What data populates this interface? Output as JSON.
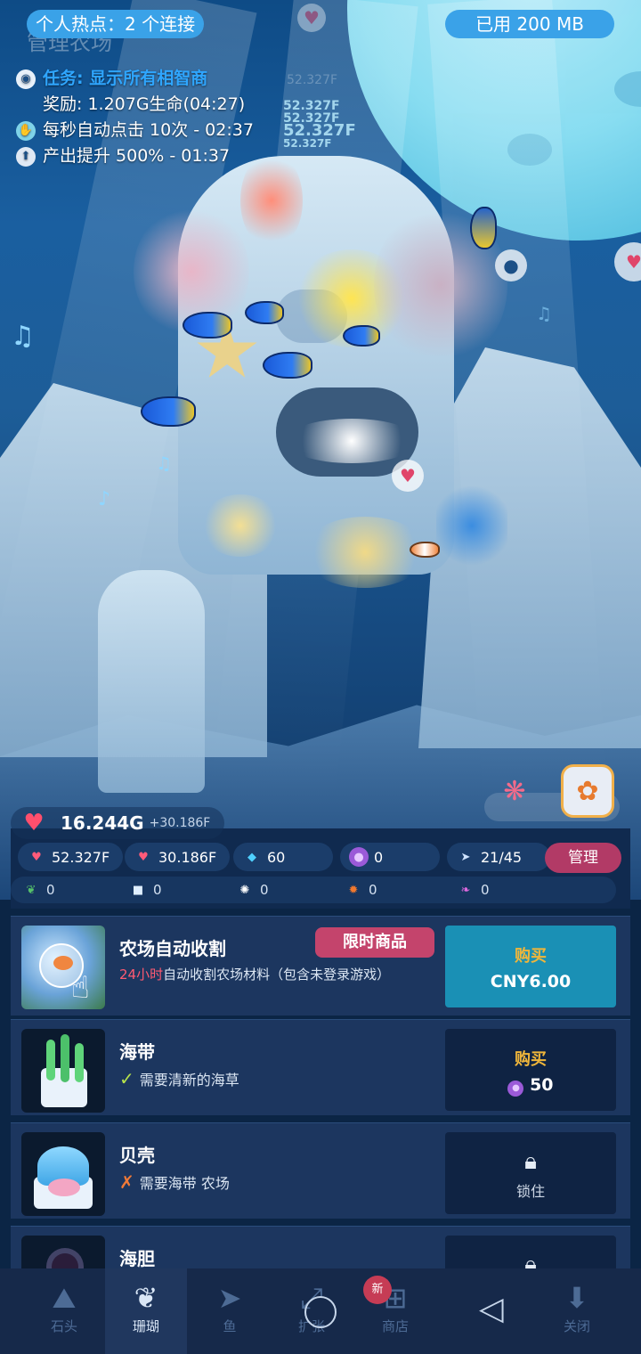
{
  "status_bar": {
    "hotspot": "个人热点：2 个连接",
    "data_used": "已用 200 MB"
  },
  "farm_title": "管理农场",
  "info": {
    "task_label": "任务",
    "task_text": ": 显示所有相智商",
    "reward": "奖励: 1.207G生命(04:27)",
    "auto_click": "每秒自动点击 10次 - 02:37",
    "production_boost": "产出提升 500% - 01:37"
  },
  "floating_numbers": [
    "52.327F",
    "52.327F",
    "52.327F",
    "52.327F",
    "52.327F"
  ],
  "life": {
    "value": "16.244G",
    "rate": "+30.186F"
  },
  "stats": {
    "tap_life": "52.327F",
    "auto_life": "30.186F",
    "gems": "60",
    "pearls": "0",
    "fish": "21/45",
    "manage_label": "管理"
  },
  "materials": [
    "0",
    "0",
    "0",
    "0",
    "0"
  ],
  "shop": {
    "items": [
      {
        "name": "农场自动收割",
        "tag": "限时商品",
        "desc_highlight": "24小时",
        "desc": "自动收割农场材料（包含未登录游戏）",
        "buy_label": "购买",
        "price": "CNY6.00"
      },
      {
        "name": "海带",
        "desc": "需要清新的海草",
        "buy_label": "购买",
        "price": "50"
      },
      {
        "name": "贝壳",
        "desc": "需要海带 农场",
        "lock_label": "锁住"
      },
      {
        "name": "海胆"
      }
    ]
  },
  "nav": {
    "items": [
      "石头",
      "珊瑚",
      "鱼",
      "扩张",
      "商店",
      "关闭"
    ],
    "badge": "新"
  },
  "colors": {
    "accent_pink": "#c4446c",
    "buy_teal": "#1a90b5",
    "gold": "#f0b63a",
    "pill_blue": "#3aa2e8"
  }
}
